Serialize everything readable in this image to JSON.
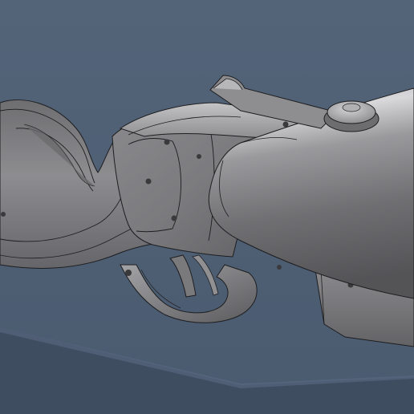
{
  "viewport": {
    "background": "#4d5e74",
    "ground_color": "#3c4a5d",
    "model_body": "#7f7f82",
    "model_highlight": "#c9c9cb",
    "model_shadow": "#4d4d50",
    "edge_color": "#1e1e20"
  },
  "model": {
    "parts": [
      "stock",
      "receiver",
      "barrel",
      "trigger-guard",
      "trigger",
      "rear-sight",
      "fore-end",
      "screws"
    ]
  }
}
